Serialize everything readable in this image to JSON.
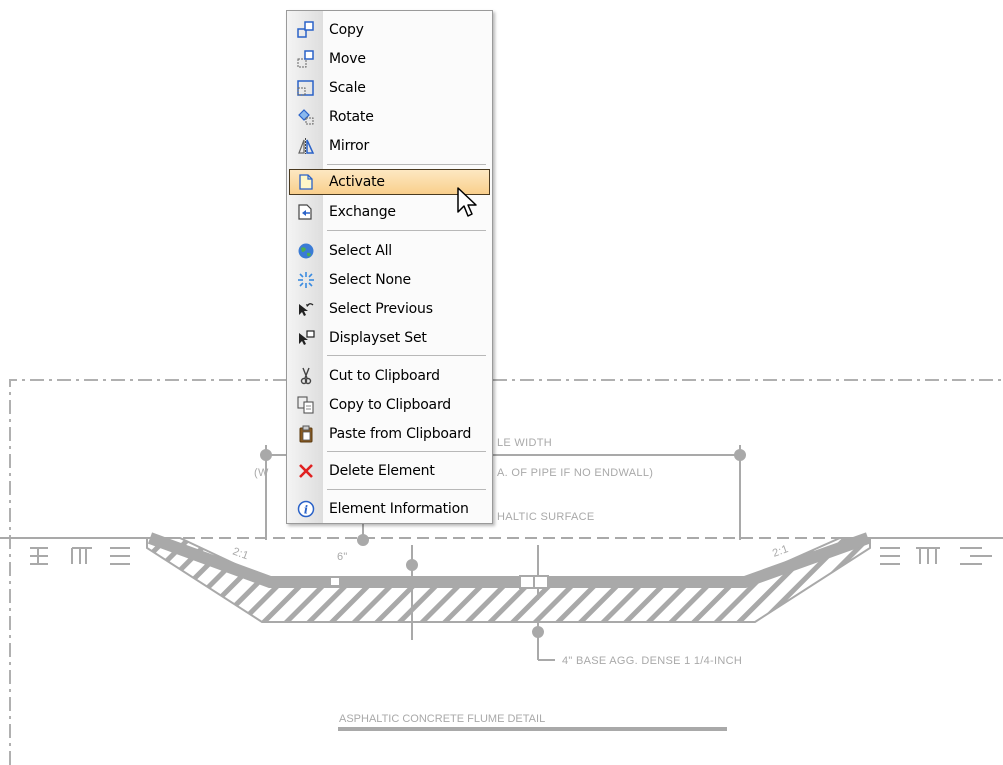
{
  "drawing": {
    "title": "ASPHALTIC CONCRETE FLUME DETAIL",
    "label_width": "LE WIDTH",
    "label_pipe": "A. OF PIPE IF NO ENDWALL)",
    "label_pipe_prefix": "(W",
    "label_surface": "HALTIC SURFACE",
    "label_base": "4\" BASE AGG. DENSE 1 1/4-INCH",
    "label_depth": "6\"",
    "slope_left": "2:1",
    "slope_right": "2:1"
  },
  "menu": {
    "items": [
      {
        "label": "Copy",
        "icon": "copy-icon"
      },
      {
        "label": "Move",
        "icon": "move-icon"
      },
      {
        "label": "Scale",
        "icon": "scale-icon"
      },
      {
        "label": "Rotate",
        "icon": "rotate-icon"
      },
      {
        "label": "Mirror",
        "icon": "mirror-icon"
      },
      {
        "label": "Activate",
        "icon": "activate-icon",
        "highlighted": true
      },
      {
        "label": "Exchange",
        "icon": "exchange-icon"
      },
      {
        "label": "Select All",
        "icon": "globe-icon"
      },
      {
        "label": "Select None",
        "icon": "sparkle-icon"
      },
      {
        "label": "Select Previous",
        "icon": "select-previous-icon"
      },
      {
        "label": "Displayset Set",
        "icon": "displayset-icon"
      },
      {
        "label": "Cut to Clipboard",
        "icon": "scissors-icon"
      },
      {
        "label": "Copy to Clipboard",
        "icon": "copy-clipboard-icon"
      },
      {
        "label": "Paste from Clipboard",
        "icon": "paste-icon"
      },
      {
        "label": "Delete Element",
        "icon": "delete-icon"
      },
      {
        "label": "Element Information",
        "icon": "info-icon"
      }
    ]
  },
  "colors": {
    "highlight": "#f9cf8c",
    "drawing_gray": "#a9a9a9",
    "delete_red": "#e02020",
    "info_blue": "#2a62c8"
  }
}
